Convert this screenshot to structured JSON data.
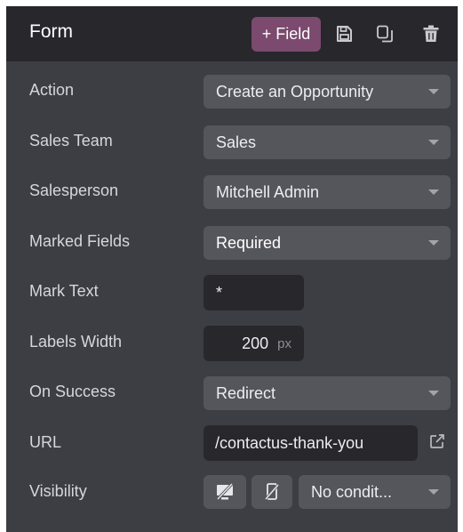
{
  "header": {
    "title": "Form",
    "add_field_label": "+ Field"
  },
  "rows": {
    "action": {
      "label": "Action",
      "value": "Create an Opportunity"
    },
    "sales_team": {
      "label": "Sales Team",
      "value": "Sales"
    },
    "salesperson": {
      "label": "Salesperson",
      "value": "Mitchell Admin"
    },
    "marked_fields": {
      "label": "Marked Fields",
      "value": "Required"
    },
    "mark_text": {
      "label": "Mark Text",
      "value": "*"
    },
    "labels_width": {
      "label": "Labels Width",
      "value": "200",
      "unit": "px"
    },
    "on_success": {
      "label": "On Success",
      "value": "Redirect"
    },
    "url": {
      "label": "URL",
      "value": "/contactus-thank-you"
    },
    "visibility": {
      "label": "Visibility",
      "value": "No condit..."
    }
  },
  "icons": {
    "save": "save-icon",
    "duplicate": "duplicate-icon",
    "delete": "trash-icon",
    "external_link": "external-link-icon",
    "visibility_desktop": "desktop-hidden-icon",
    "visibility_mobile": "mobile-hidden-icon"
  },
  "colors": {
    "panel_bg": "#3d3d44",
    "header_bg": "#27272c",
    "accent": "#7b4a6e",
    "select_bg": "#55555c",
    "input_bg": "#27272c"
  }
}
